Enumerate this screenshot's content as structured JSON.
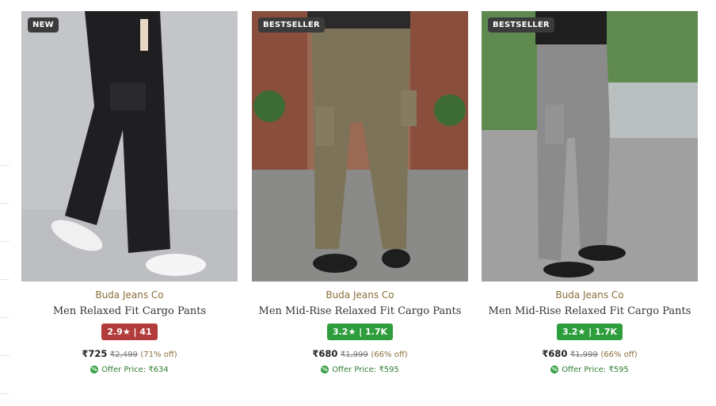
{
  "products": [
    {
      "badge": "NEW",
      "brand": "Buda Jeans Co",
      "name": "Men Relaxed Fit Cargo Pants",
      "rating": "2.9★ | 41",
      "rating_color": "#b23b3b",
      "price": "₹725",
      "mrp": "₹2,499",
      "discount": "(71% off)",
      "offer": "Offer Price: ₹634"
    },
    {
      "badge": "BESTSELLER",
      "brand": "Buda Jeans Co",
      "name": "Men Mid-Rise Relaxed Fit Cargo Pants",
      "rating": "3.2★ | 1.7K",
      "rating_color": "#2e9d3b",
      "price": "₹680",
      "mrp": "₹1,999",
      "discount": "(66% off)",
      "offer": "Offer Price: ₹595"
    },
    {
      "badge": "BESTSELLER",
      "brand": "Buda Jeans Co",
      "name": "Men Mid-Rise Relaxed Fit Cargo Pants",
      "rating": "3.2★ | 1.7K",
      "rating_color": "#2e9d3b",
      "price": "₹680",
      "mrp": "₹1,999",
      "discount": "(66% off)",
      "offer": "Offer Price: ₹595"
    }
  ],
  "icons": {
    "offer": "offer-tag-icon"
  },
  "colors": {
    "brand": "#8a6d3b",
    "offer_green": "#2e7d32"
  }
}
